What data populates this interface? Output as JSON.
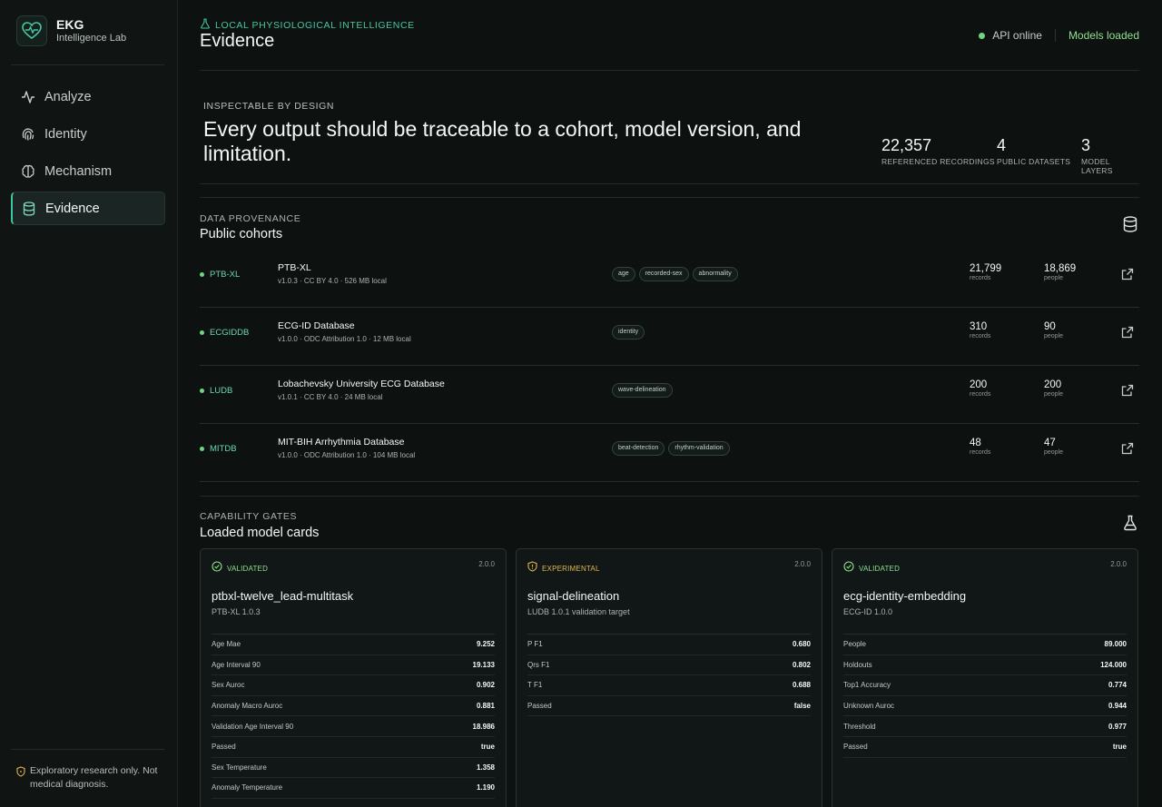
{
  "brand": {
    "name": "EKG",
    "subtitle": "Intelligence Lab"
  },
  "nav": [
    {
      "label": "Analyze",
      "icon": "pulse-icon"
    },
    {
      "label": "Identity",
      "icon": "fingerprint-icon"
    },
    {
      "label": "Mechanism",
      "icon": "brain-icon"
    },
    {
      "label": "Evidence",
      "icon": "database-icon",
      "active": true
    }
  ],
  "footer_note": "Exploratory research only. Not medical diagnosis.",
  "header": {
    "eyebrow": "LOCAL PHYSIOLOGICAL INTELLIGENCE",
    "title": "Evidence",
    "api_status": "API online",
    "models_status": "Models loaded"
  },
  "hero": {
    "eyebrow": "INSPECTABLE BY DESIGN",
    "title": "Every output should be traceable to a cohort, model version, and limitation.",
    "stats": [
      {
        "value": "22,357",
        "label": "REFERENCED RECORDINGS"
      },
      {
        "value": "4",
        "label": "PUBLIC DATASETS"
      },
      {
        "value": "3",
        "label": "MODEL LAYERS"
      }
    ]
  },
  "provenance": {
    "eyebrow": "DATA PROVENANCE",
    "title": "Public cohorts",
    "records_label": "records",
    "people_label": "people",
    "rows": [
      {
        "code": "PTB-XL",
        "name": "PTB-XL",
        "meta": "v1.0.3 · CC BY 4.0 · 526 MB local",
        "tags": [
          "age",
          "recorded-sex",
          "abnormality"
        ],
        "records": "21,799",
        "people": "18,869"
      },
      {
        "code": "ECGIDDB",
        "name": "ECG-ID Database",
        "meta": "v1.0.0 · ODC Attribution 1.0 · 12 MB local",
        "tags": [
          "identity"
        ],
        "records": "310",
        "people": "90"
      },
      {
        "code": "LUDB",
        "name": "Lobachevsky University ECG Database",
        "meta": "v1.0.1 · CC BY 4.0 · 24 MB local",
        "tags": [
          "wave-delineation"
        ],
        "records": "200",
        "people": "200"
      },
      {
        "code": "MITDB",
        "name": "MIT-BIH Arrhythmia Database",
        "meta": "v1.0.0 · ODC Attribution 1.0 · 104 MB local",
        "tags": [
          "beat-detection",
          "rhythm-validation"
        ],
        "records": "48",
        "people": "47"
      }
    ]
  },
  "gates": {
    "eyebrow": "CAPABILITY GATES",
    "title": "Loaded model cards",
    "cards": [
      {
        "badge": "VALIDATED",
        "badge_color": "#8ee08f",
        "version": "2.0.0",
        "name": "ptbxl-twelve_lead-multitask",
        "sub": "PTB-XL 1.0.3",
        "metrics": [
          [
            "Age Mae",
            "9.252"
          ],
          [
            "Age Interval 90",
            "19.133"
          ],
          [
            "Sex Auroc",
            "0.902"
          ],
          [
            "Anomaly Macro Auroc",
            "0.881"
          ],
          [
            "Validation Age Interval 90",
            "18.986"
          ],
          [
            "Passed",
            "true"
          ],
          [
            "Sex Temperature",
            "1.358"
          ],
          [
            "Anomaly Temperature",
            "1.190"
          ]
        ]
      },
      {
        "badge": "EXPERIMENTAL",
        "badge_color": "#e2b84a",
        "version": "2.0.0",
        "name": "signal-delineation",
        "sub": "LUDB 1.0.1 validation target",
        "metrics": [
          [
            "P F1",
            "0.680"
          ],
          [
            "Qrs F1",
            "0.802"
          ],
          [
            "T F1",
            "0.688"
          ],
          [
            "Passed",
            "false"
          ]
        ]
      },
      {
        "badge": "VALIDATED",
        "badge_color": "#8ee08f",
        "version": "2.0.0",
        "name": "ecg-identity-embedding",
        "sub": "ECG-ID 1.0.0",
        "metrics": [
          [
            "People",
            "89.000"
          ],
          [
            "Holdouts",
            "124.000"
          ],
          [
            "Top1 Accuracy",
            "0.774"
          ],
          [
            "Unknown Auroc",
            "0.944"
          ],
          [
            "Threshold",
            "0.977"
          ],
          [
            "Passed",
            "true"
          ]
        ]
      }
    ]
  }
}
